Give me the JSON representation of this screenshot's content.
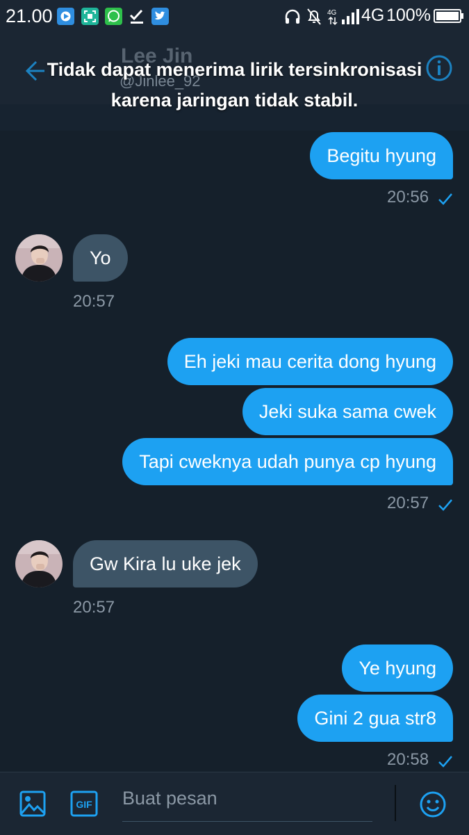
{
  "status_bar": {
    "time": "21.00",
    "network_4g": "4G",
    "battery": "100%"
  },
  "header": {
    "name": "Lee Jin",
    "handle": "@Jinlee_92"
  },
  "toast": {
    "line1": "Tidak dapat menerima lirik tersinkronisasi",
    "line2": "karena jaringan tidak stabil."
  },
  "messages": [
    {
      "text": "Begitu hyung"
    },
    {
      "text": "Yo"
    },
    {
      "text": "Eh jeki mau cerita dong hyung"
    },
    {
      "text": "Jeki suka sama cwek"
    },
    {
      "text": "Tapi cweknya udah punya cp hyung"
    },
    {
      "text": "Gw Kira lu uke jek"
    },
    {
      "text": "Ye hyung"
    },
    {
      "text": "Gini 2 gua str8"
    }
  ],
  "timestamps": [
    "20:56",
    "20:57",
    "20:57",
    "20:57",
    "20:58"
  ],
  "composer": {
    "placeholder": "Buat pesan",
    "gif_label": "GIF"
  },
  "colors": {
    "background": "#15202b",
    "outgoing_bubble": "#1da1f2",
    "incoming_bubble": "#3d5466",
    "accent": "#1da1f2",
    "muted_text": "#8b98a5"
  }
}
